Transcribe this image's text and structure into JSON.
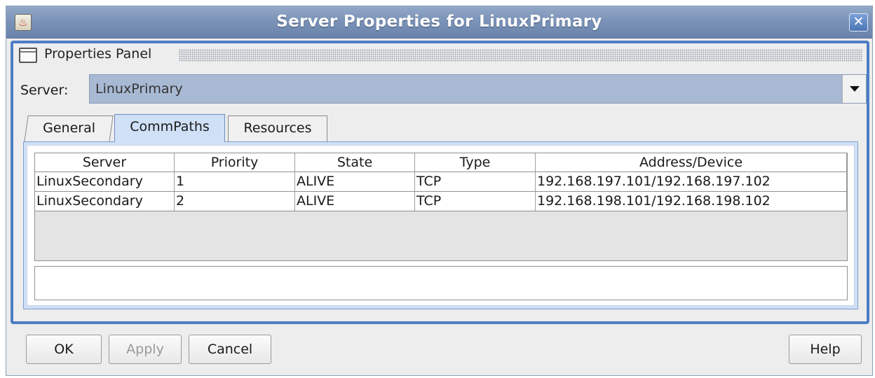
{
  "window": {
    "title": "Server Properties for LinuxPrimary",
    "close_glyph": "✕"
  },
  "panel": {
    "title": "Properties Panel"
  },
  "server": {
    "label": "Server:",
    "selected": "LinuxPrimary"
  },
  "tabs": [
    {
      "label": "General",
      "active": false
    },
    {
      "label": "CommPaths",
      "active": true
    },
    {
      "label": "Resources",
      "active": false
    }
  ],
  "table": {
    "columns": [
      "Server",
      "Priority",
      "State",
      "Type",
      "Address/Device"
    ],
    "rows": [
      [
        "LinuxSecondary",
        "1",
        "ALIVE",
        "TCP",
        "192.168.197.101/192.168.197.102"
      ],
      [
        "LinuxSecondary",
        "2",
        "ALIVE",
        "TCP",
        "192.168.198.101/192.168.198.102"
      ]
    ]
  },
  "buttons": {
    "ok": "OK",
    "apply": "Apply",
    "cancel": "Cancel",
    "help": "Help"
  },
  "colors": {
    "titlebar": "#7b93b8",
    "frame": "#4e7dc6",
    "active_tab": "#cfe0f7"
  }
}
